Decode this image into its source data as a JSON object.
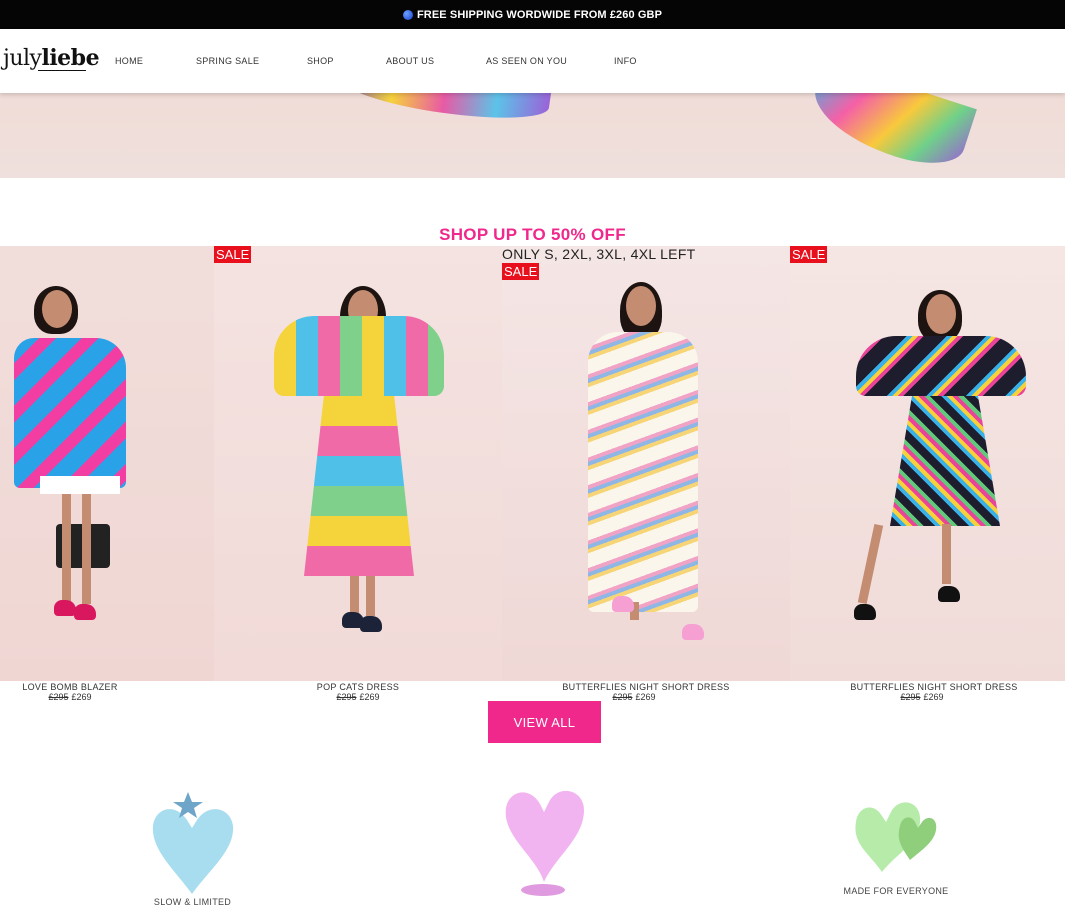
{
  "announcement": {
    "text": "FREE SHIPPING WORDWIDE FROM £260 GBP",
    "icon": "globe-icon"
  },
  "logo": {
    "light": "july",
    "bold": "liebe"
  },
  "nav": {
    "items": [
      "HOME",
      "SPRING SALE",
      "SHOP",
      "ABOUT US",
      "AS SEEN ON YOU",
      "INFO"
    ]
  },
  "section": {
    "title": "SHOP UP TO 50% OFF"
  },
  "products": [
    {
      "name": "LOVE BOMB BLAZER",
      "old_price": "£295",
      "price": "£269"
    },
    {
      "name": "POP CATS DRESS",
      "old_price": "£295",
      "price": "£269",
      "badge": "SALE"
    },
    {
      "name": "BUTTERFLIES NIGHT SHORT DRESS",
      "old_price": "£295",
      "price": "£269",
      "badge": "SALE",
      "note": "ONLY S, 2XL, 3XL, 4XL LEFT"
    },
    {
      "name": "BUTTERFLIES NIGHT SHORT DRESS",
      "old_price": "£295",
      "price": "£269",
      "badge": "SALE"
    }
  ],
  "cta": {
    "view_all": "VIEW ALL"
  },
  "features": [
    {
      "label": "SLOW & LIMITED",
      "icon": "blue-heart-star-icon",
      "color": "#a8ddef"
    },
    {
      "label": "",
      "icon": "pink-heart-icon",
      "color": "#f2b3f1"
    },
    {
      "label": "MADE FOR EVERYONE",
      "icon": "green-hearts-icon",
      "color": "#b6eba9"
    }
  ],
  "colors": {
    "accent": "#f0288c",
    "sale": "#e8101c",
    "topbar": "#050505"
  }
}
